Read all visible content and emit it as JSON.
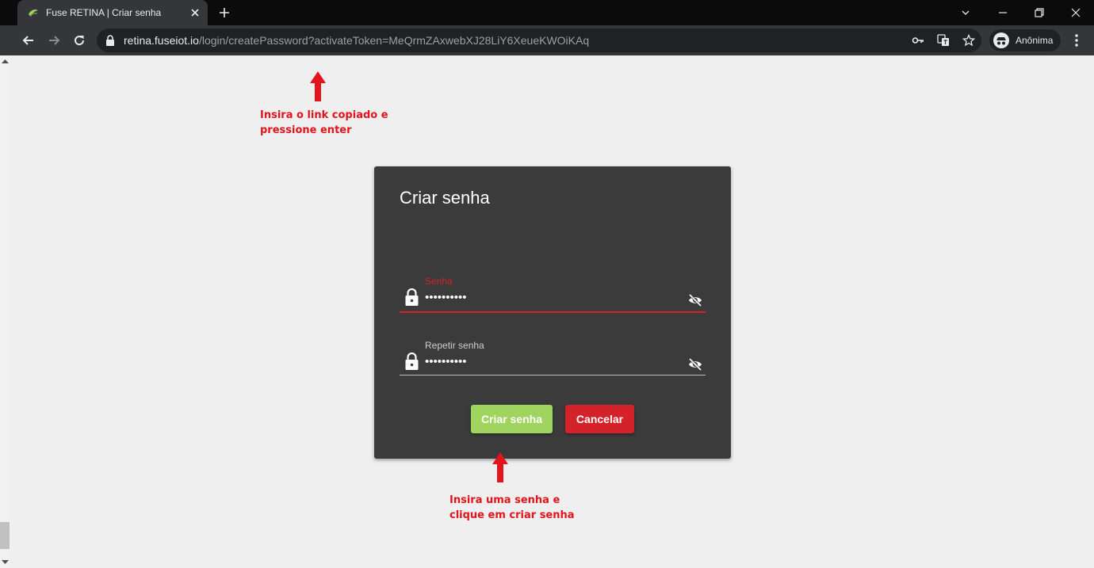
{
  "browser": {
    "tab_title": "Fuse RETINA | Criar senha",
    "url_host": "retina.fuseiot.io",
    "url_path": "/login/createPassword?activateToken=MeQrmZAxwebXJ28LiY6XeueKWOiKAq",
    "profile_label": "Anônima",
    "icons": [
      "back-icon",
      "forward-icon",
      "reload-icon",
      "lock-icon",
      "key-icon",
      "translate-icon",
      "star-icon",
      "incognito-icon",
      "menu-icon"
    ]
  },
  "annotations": {
    "top_line1": "Insira o link copiado e",
    "top_line2": "pressione enter",
    "bottom_line1": "Insira uma senha e",
    "bottom_line2": "clique em criar senha",
    "color": "#e3141c"
  },
  "form": {
    "title": "Criar senha",
    "password_label": "Senha",
    "password_value": "••••••••••",
    "repeat_label": "Repetir senha",
    "repeat_value": "••••••••••",
    "submit_label": "Criar senha",
    "cancel_label": "Cancelar",
    "colors": {
      "card": "#3b3b3b",
      "focus": "#d32229",
      "submit": "#9fd45f",
      "cancel": "#d32229"
    }
  }
}
